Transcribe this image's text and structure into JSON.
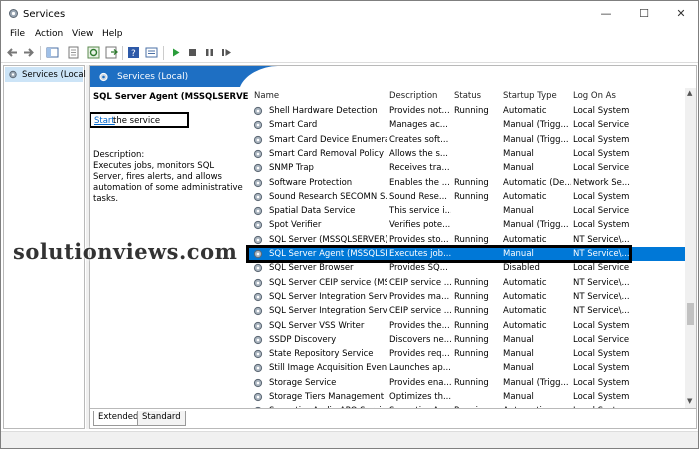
{
  "window": {
    "title": "Services",
    "minimize": "—",
    "maximize": "☐",
    "close": "✕"
  },
  "menu": [
    "File",
    "Action",
    "View",
    "Help"
  ],
  "left_pane": {
    "label": "Services (Local)"
  },
  "right_pane": {
    "header": "Services (Local)",
    "selected_service": {
      "name": "SQL Server Agent (MSSQLSERVER)",
      "start_link": "Start",
      "start_rest": " the service",
      "description_label": "Description:",
      "description": "Executes jobs, monitors SQL Server, fires alerts, and allows automation of some administrative tasks."
    },
    "columns": [
      "Name",
      "Description",
      "Status",
      "Startup Type",
      "Log On As"
    ],
    "rows": [
      [
        "Shell Hardware Detection",
        "Provides not...",
        "Running",
        "Automatic",
        "Local System"
      ],
      [
        "Smart Card",
        "Manages ac...",
        "",
        "Manual (Trigg...",
        "Local Service"
      ],
      [
        "Smart Card Device Enumerat...",
        "Creates soft...",
        "",
        "Manual (Trigg...",
        "Local System"
      ],
      [
        "Smart Card Removal Policy",
        "Allows the s...",
        "",
        "Manual",
        "Local System"
      ],
      [
        "SNMP Trap",
        "Receives tra...",
        "",
        "Manual",
        "Local Service"
      ],
      [
        "Software Protection",
        "Enables the ...",
        "Running",
        "Automatic (De...",
        "Network Se..."
      ],
      [
        "Sound Research SECOMN S...",
        "Sound Rese...",
        "Running",
        "Automatic",
        "Local System"
      ],
      [
        "Spatial Data Service",
        "This service i...",
        "",
        "Manual",
        "Local Service"
      ],
      [
        "Spot Verifier",
        "Verifies pote...",
        "",
        "Manual (Trigg...",
        "Local System"
      ],
      [
        "SQL Server (MSSQLSERVER)",
        "Provides sto...",
        "Running",
        "Automatic",
        "NT Service\\..."
      ],
      [
        "SQL Server Agent (MSSQLSE...",
        "Executes job...",
        "",
        "Manual",
        "NT Service\\..."
      ],
      [
        "SQL Server Browser",
        "Provides SQ...",
        "",
        "Disabled",
        "Local Service"
      ],
      [
        "SQL Server CEIP service (MSS...",
        "CEIP service ...",
        "Running",
        "Automatic",
        "NT Service\\..."
      ],
      [
        "SQL Server Integration Servi...",
        "Provides ma...",
        "Running",
        "Automatic",
        "NT Service\\..."
      ],
      [
        "SQL Server Integration Servi...",
        "CEIP service ...",
        "Running",
        "Automatic",
        "NT Service\\..."
      ],
      [
        "SQL Server VSS Writer",
        "Provides the...",
        "Running",
        "Automatic",
        "Local System"
      ],
      [
        "SSDP Discovery",
        "Discovers ne...",
        "Running",
        "Manual",
        "Local Service"
      ],
      [
        "State Repository Service",
        "Provides req...",
        "Running",
        "Manual",
        "Local System"
      ],
      [
        "Still Image Acquisition Events",
        "Launches ap...",
        "",
        "Manual",
        "Local System"
      ],
      [
        "Storage Service",
        "Provides ena...",
        "Running",
        "Manual (Trigg...",
        "Local System"
      ],
      [
        "Storage Tiers Management",
        "Optimizes th...",
        "",
        "Manual",
        "Local System"
      ],
      [
        "Synaptics Audio APO Service",
        "Synaptics Au...",
        "Running",
        "Automatic",
        "Local System"
      ]
    ],
    "selected_index": 10,
    "tabs": [
      "Extended",
      "Standard"
    ]
  },
  "watermark": "solutionviews.com",
  "colors": {
    "accent": "#1e6fc3",
    "selection": "#0078d7",
    "link": "#0066cc"
  },
  "icons": [
    "services-app-icon",
    "back-arrow-icon",
    "forward-arrow-icon",
    "gear-icon",
    "play-icon",
    "stop-icon",
    "pause-icon",
    "restart-icon"
  ]
}
